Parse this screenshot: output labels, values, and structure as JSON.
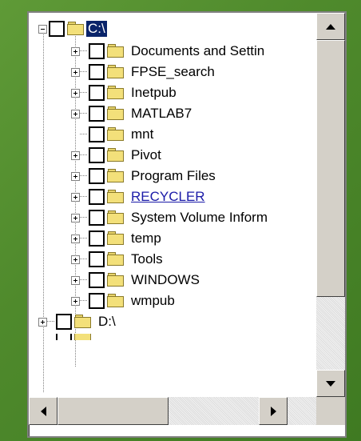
{
  "tree": {
    "root": {
      "label": "C:\\",
      "expanded": true,
      "checked": false,
      "selected": true
    },
    "children": [
      {
        "label": "Documents and Settin",
        "has_children": true
      },
      {
        "label": "FPSE_search",
        "has_children": true
      },
      {
        "label": "Inetpub",
        "has_children": true
      },
      {
        "label": "MATLAB7",
        "has_children": true
      },
      {
        "label": "mnt",
        "has_children": false
      },
      {
        "label": "Pivot",
        "has_children": true
      },
      {
        "label": "Program Files",
        "has_children": true
      },
      {
        "label": "RECYCLER",
        "has_children": true,
        "hyperlink_style": true
      },
      {
        "label": "System Volume Inform",
        "has_children": true
      },
      {
        "label": "temp",
        "has_children": true
      },
      {
        "label": "Tools",
        "has_children": true
      },
      {
        "label": "WINDOWS",
        "has_children": true
      },
      {
        "label": "wmpub",
        "has_children": true
      }
    ],
    "siblings": [
      {
        "label": "D:\\",
        "has_children": true
      }
    ]
  },
  "scrollbars": {
    "vertical_thumb_fraction": 0.78,
    "horizontal_thumb_fraction": 0.55
  },
  "colors": {
    "background": "#4f8a2c",
    "selection": "#0a246a",
    "link": "#1a1aa8",
    "folder": "#f3e07a"
  }
}
